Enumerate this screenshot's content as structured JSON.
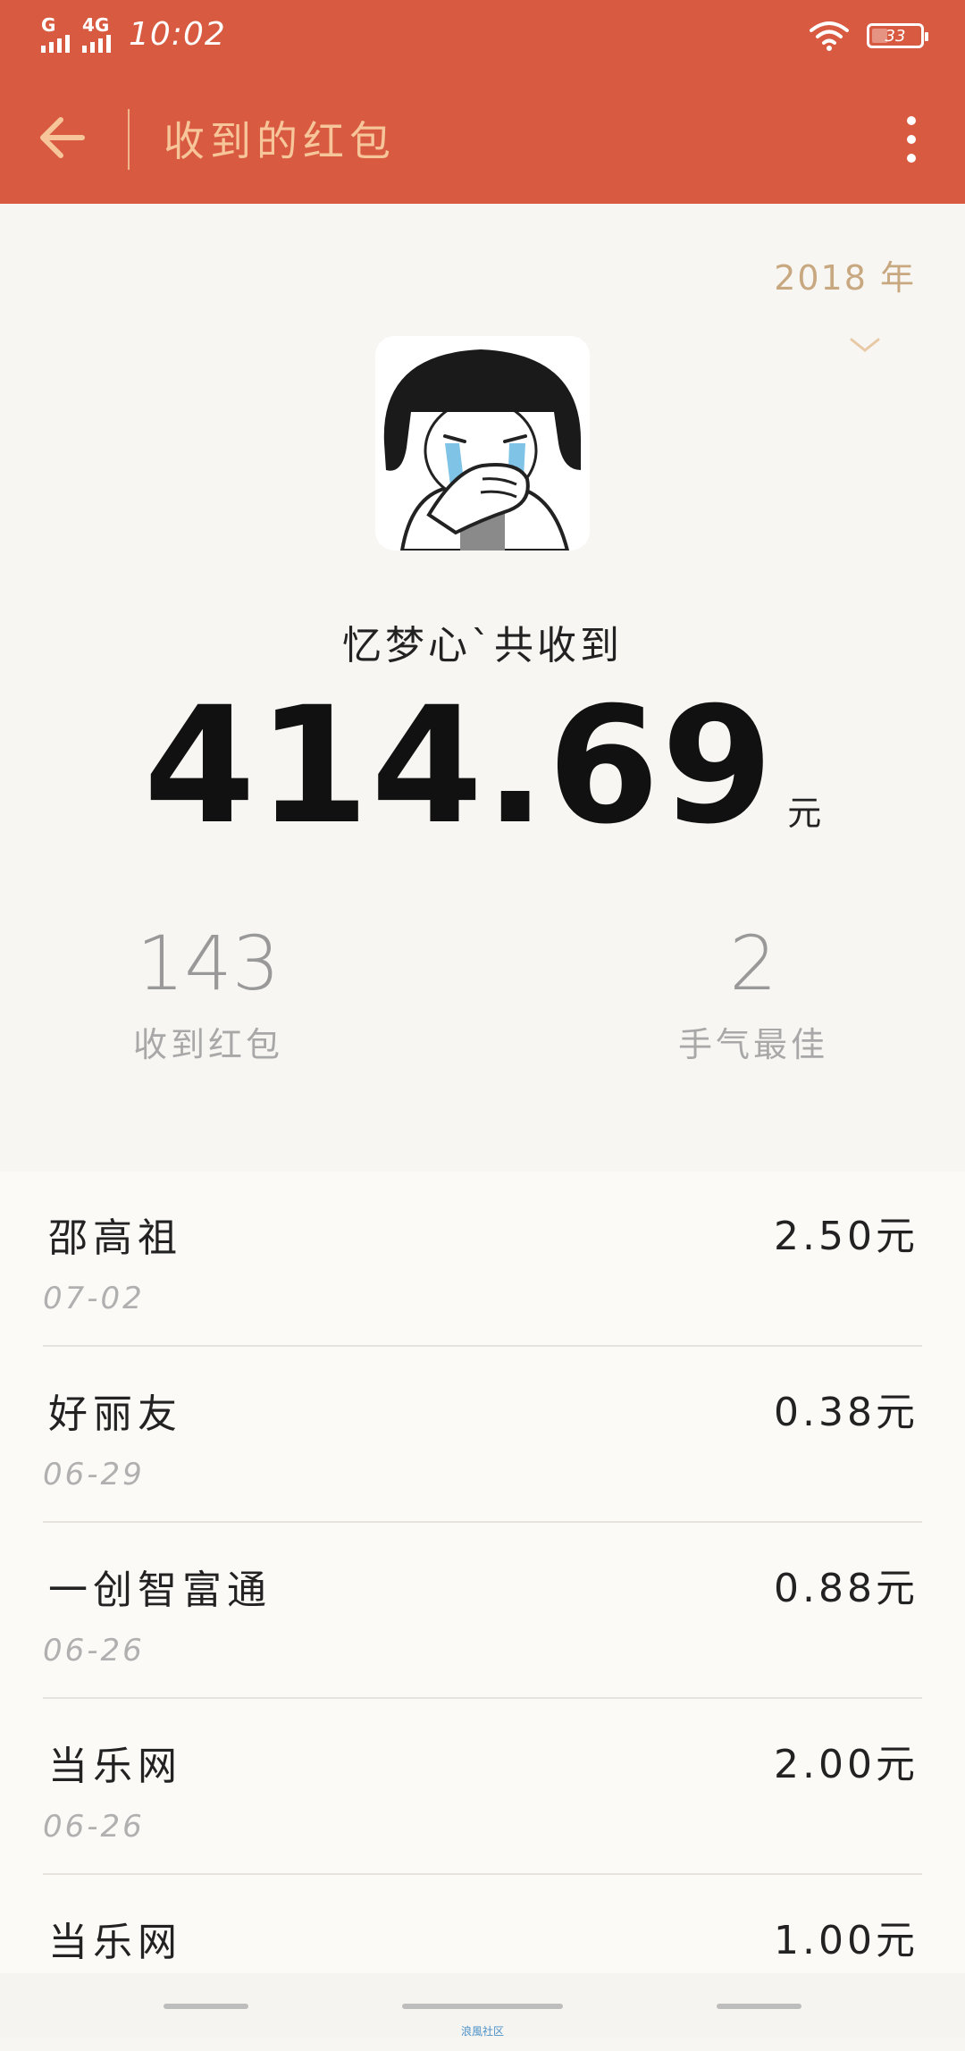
{
  "status_bar": {
    "network_1": "G",
    "network_2": "4G",
    "time": "10:02",
    "battery": "33"
  },
  "header": {
    "title": "收到的红包"
  },
  "summary": {
    "year": "2018 年",
    "name_line": "忆梦心`共收到",
    "total_amount": "414.69",
    "unit": "元",
    "received_count": "143",
    "received_label": "收到红包",
    "best_luck_count": "2",
    "best_luck_label": "手气最佳"
  },
  "records": [
    {
      "name": "邵高祖",
      "date": "07-02",
      "amount": "2.50元"
    },
    {
      "name": "好丽友",
      "date": "06-29",
      "amount": "0.38元"
    },
    {
      "name": "一创智富通",
      "date": "06-26",
      "amount": "0.88元"
    },
    {
      "name": "当乐网",
      "date": "06-26",
      "amount": "2.00元"
    },
    {
      "name": "当乐网",
      "date": "",
      "amount": "1.00元"
    }
  ],
  "watermark": "浪風社区",
  "colors": {
    "header_bg": "#D85A40",
    "title_color": "#F7C59A",
    "year_color": "#C8A880"
  }
}
